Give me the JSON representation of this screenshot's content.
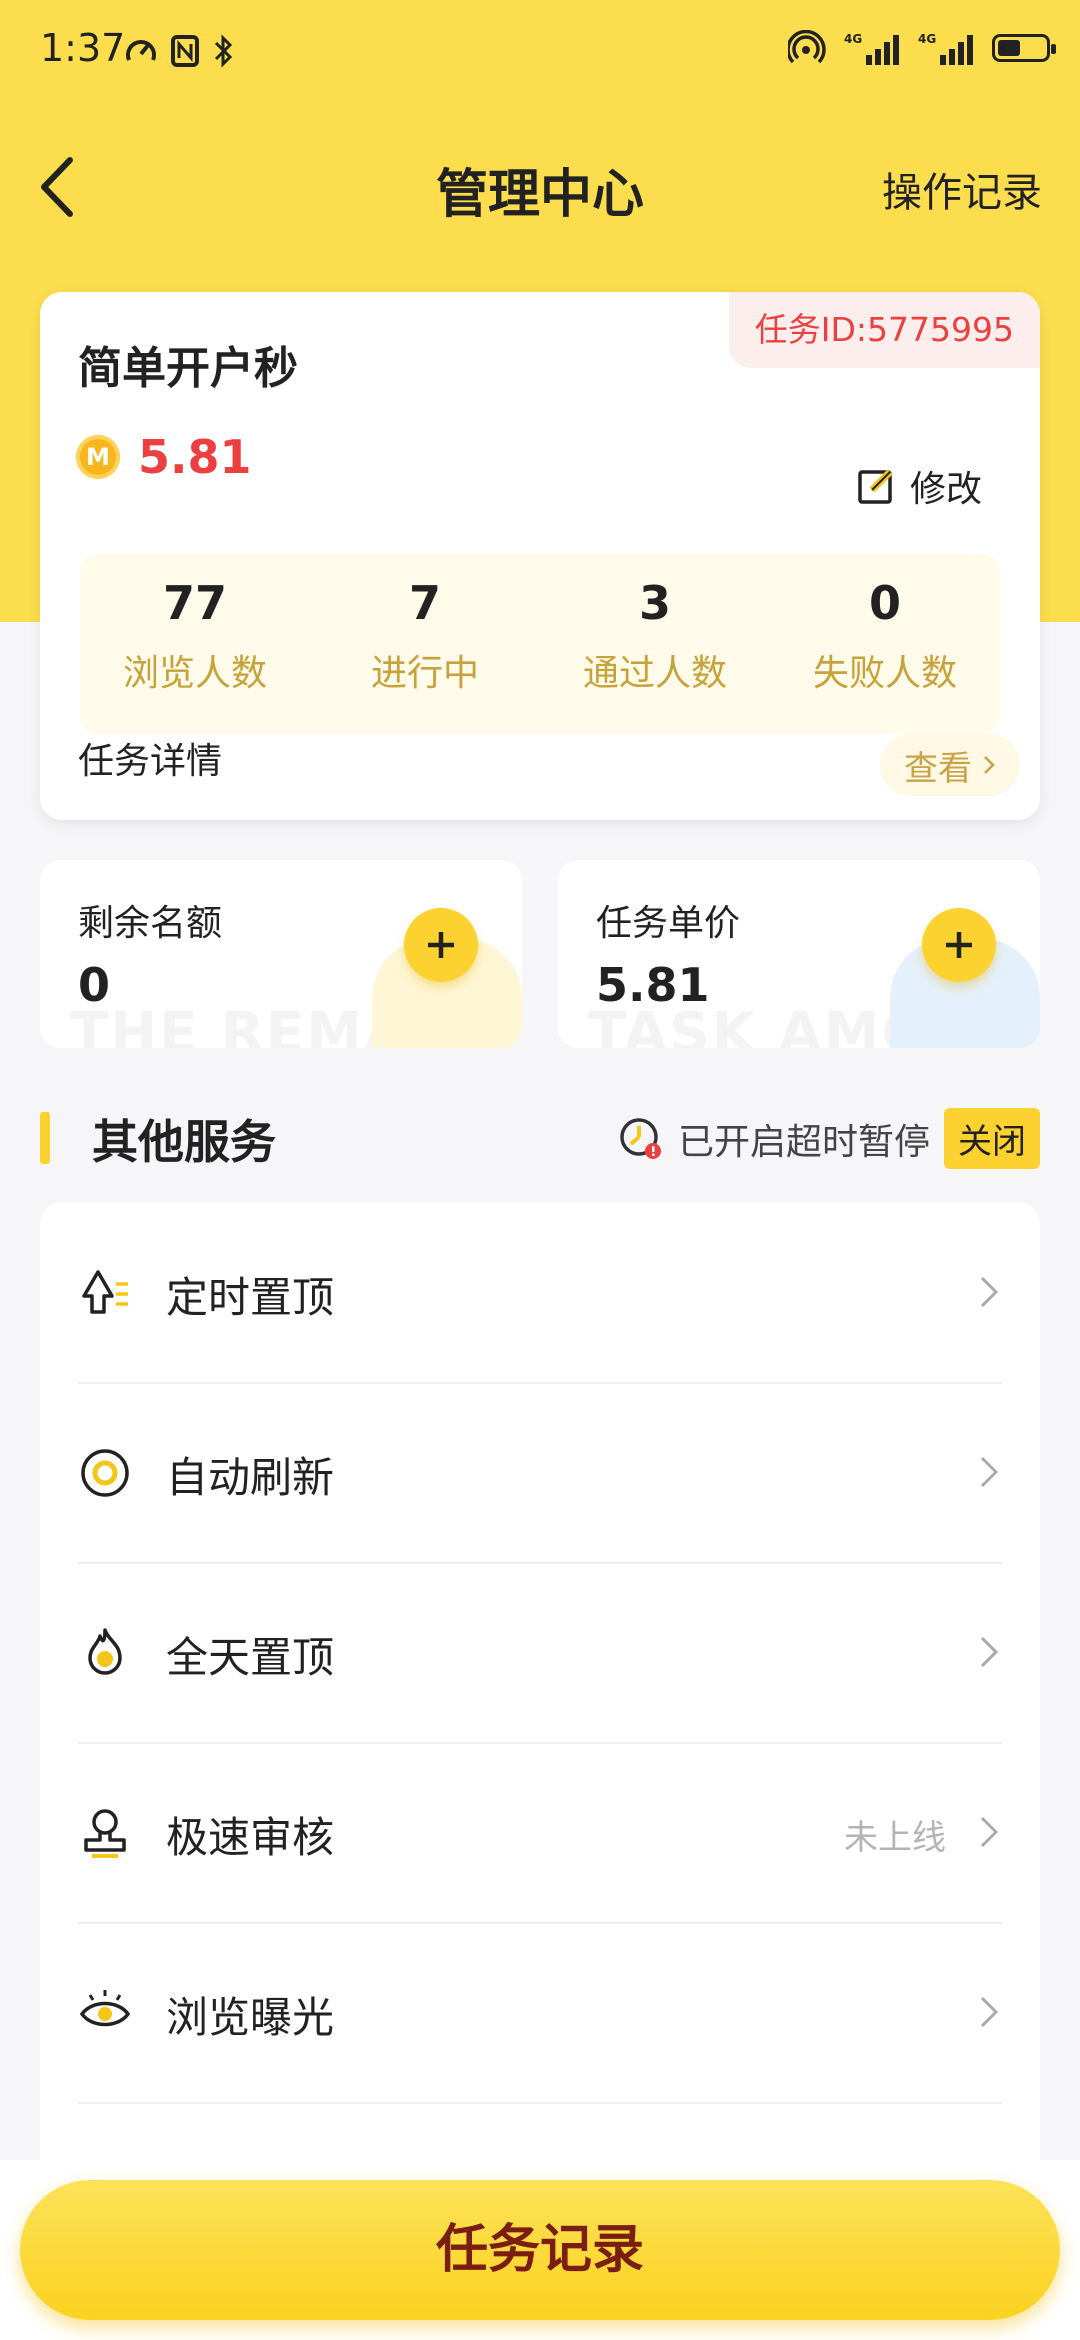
{
  "status_bar": {
    "time": "1:37"
  },
  "header": {
    "title": "管理中心",
    "action": "操作记录"
  },
  "task": {
    "id_label": "任务ID:5775995",
    "name": "简单开户秒",
    "coin_letter": "M",
    "price": "5.81",
    "edit_label": "修改",
    "stats": [
      {
        "value": "77",
        "label": "浏览人数"
      },
      {
        "value": "7",
        "label": "进行中"
      },
      {
        "value": "3",
        "label": "通过人数"
      },
      {
        "value": "0",
        "label": "失败人数"
      }
    ],
    "detail_label": "任务详情",
    "view_label": "查看"
  },
  "quota_card": {
    "label": "剩余名额",
    "value": "0",
    "watermark": "THE REMAI"
  },
  "unit_price_card": {
    "label": "任务单价",
    "value": "5.81",
    "watermark": "TASK AMOU"
  },
  "other_services": {
    "title": "其他服务",
    "pause_text": "已开启超时暂停",
    "close_label": "关闭",
    "items": [
      {
        "label": "定时置顶",
        "icon": "timed-top-icon",
        "status": ""
      },
      {
        "label": "自动刷新",
        "icon": "auto-refresh-icon",
        "status": ""
      },
      {
        "label": "全天置顶",
        "icon": "flame-icon",
        "status": ""
      },
      {
        "label": "极速审核",
        "icon": "stamp-icon",
        "status": "未上线"
      },
      {
        "label": "浏览曝光",
        "icon": "eye-icon",
        "status": ""
      }
    ]
  },
  "bottom_button": {
    "label": "任务记录"
  },
  "colors": {
    "accent": "#fbd22f",
    "header_bg": "#fbdd4d",
    "price_red": "#ec3f3f",
    "stat_gold": "#c7a23a"
  }
}
